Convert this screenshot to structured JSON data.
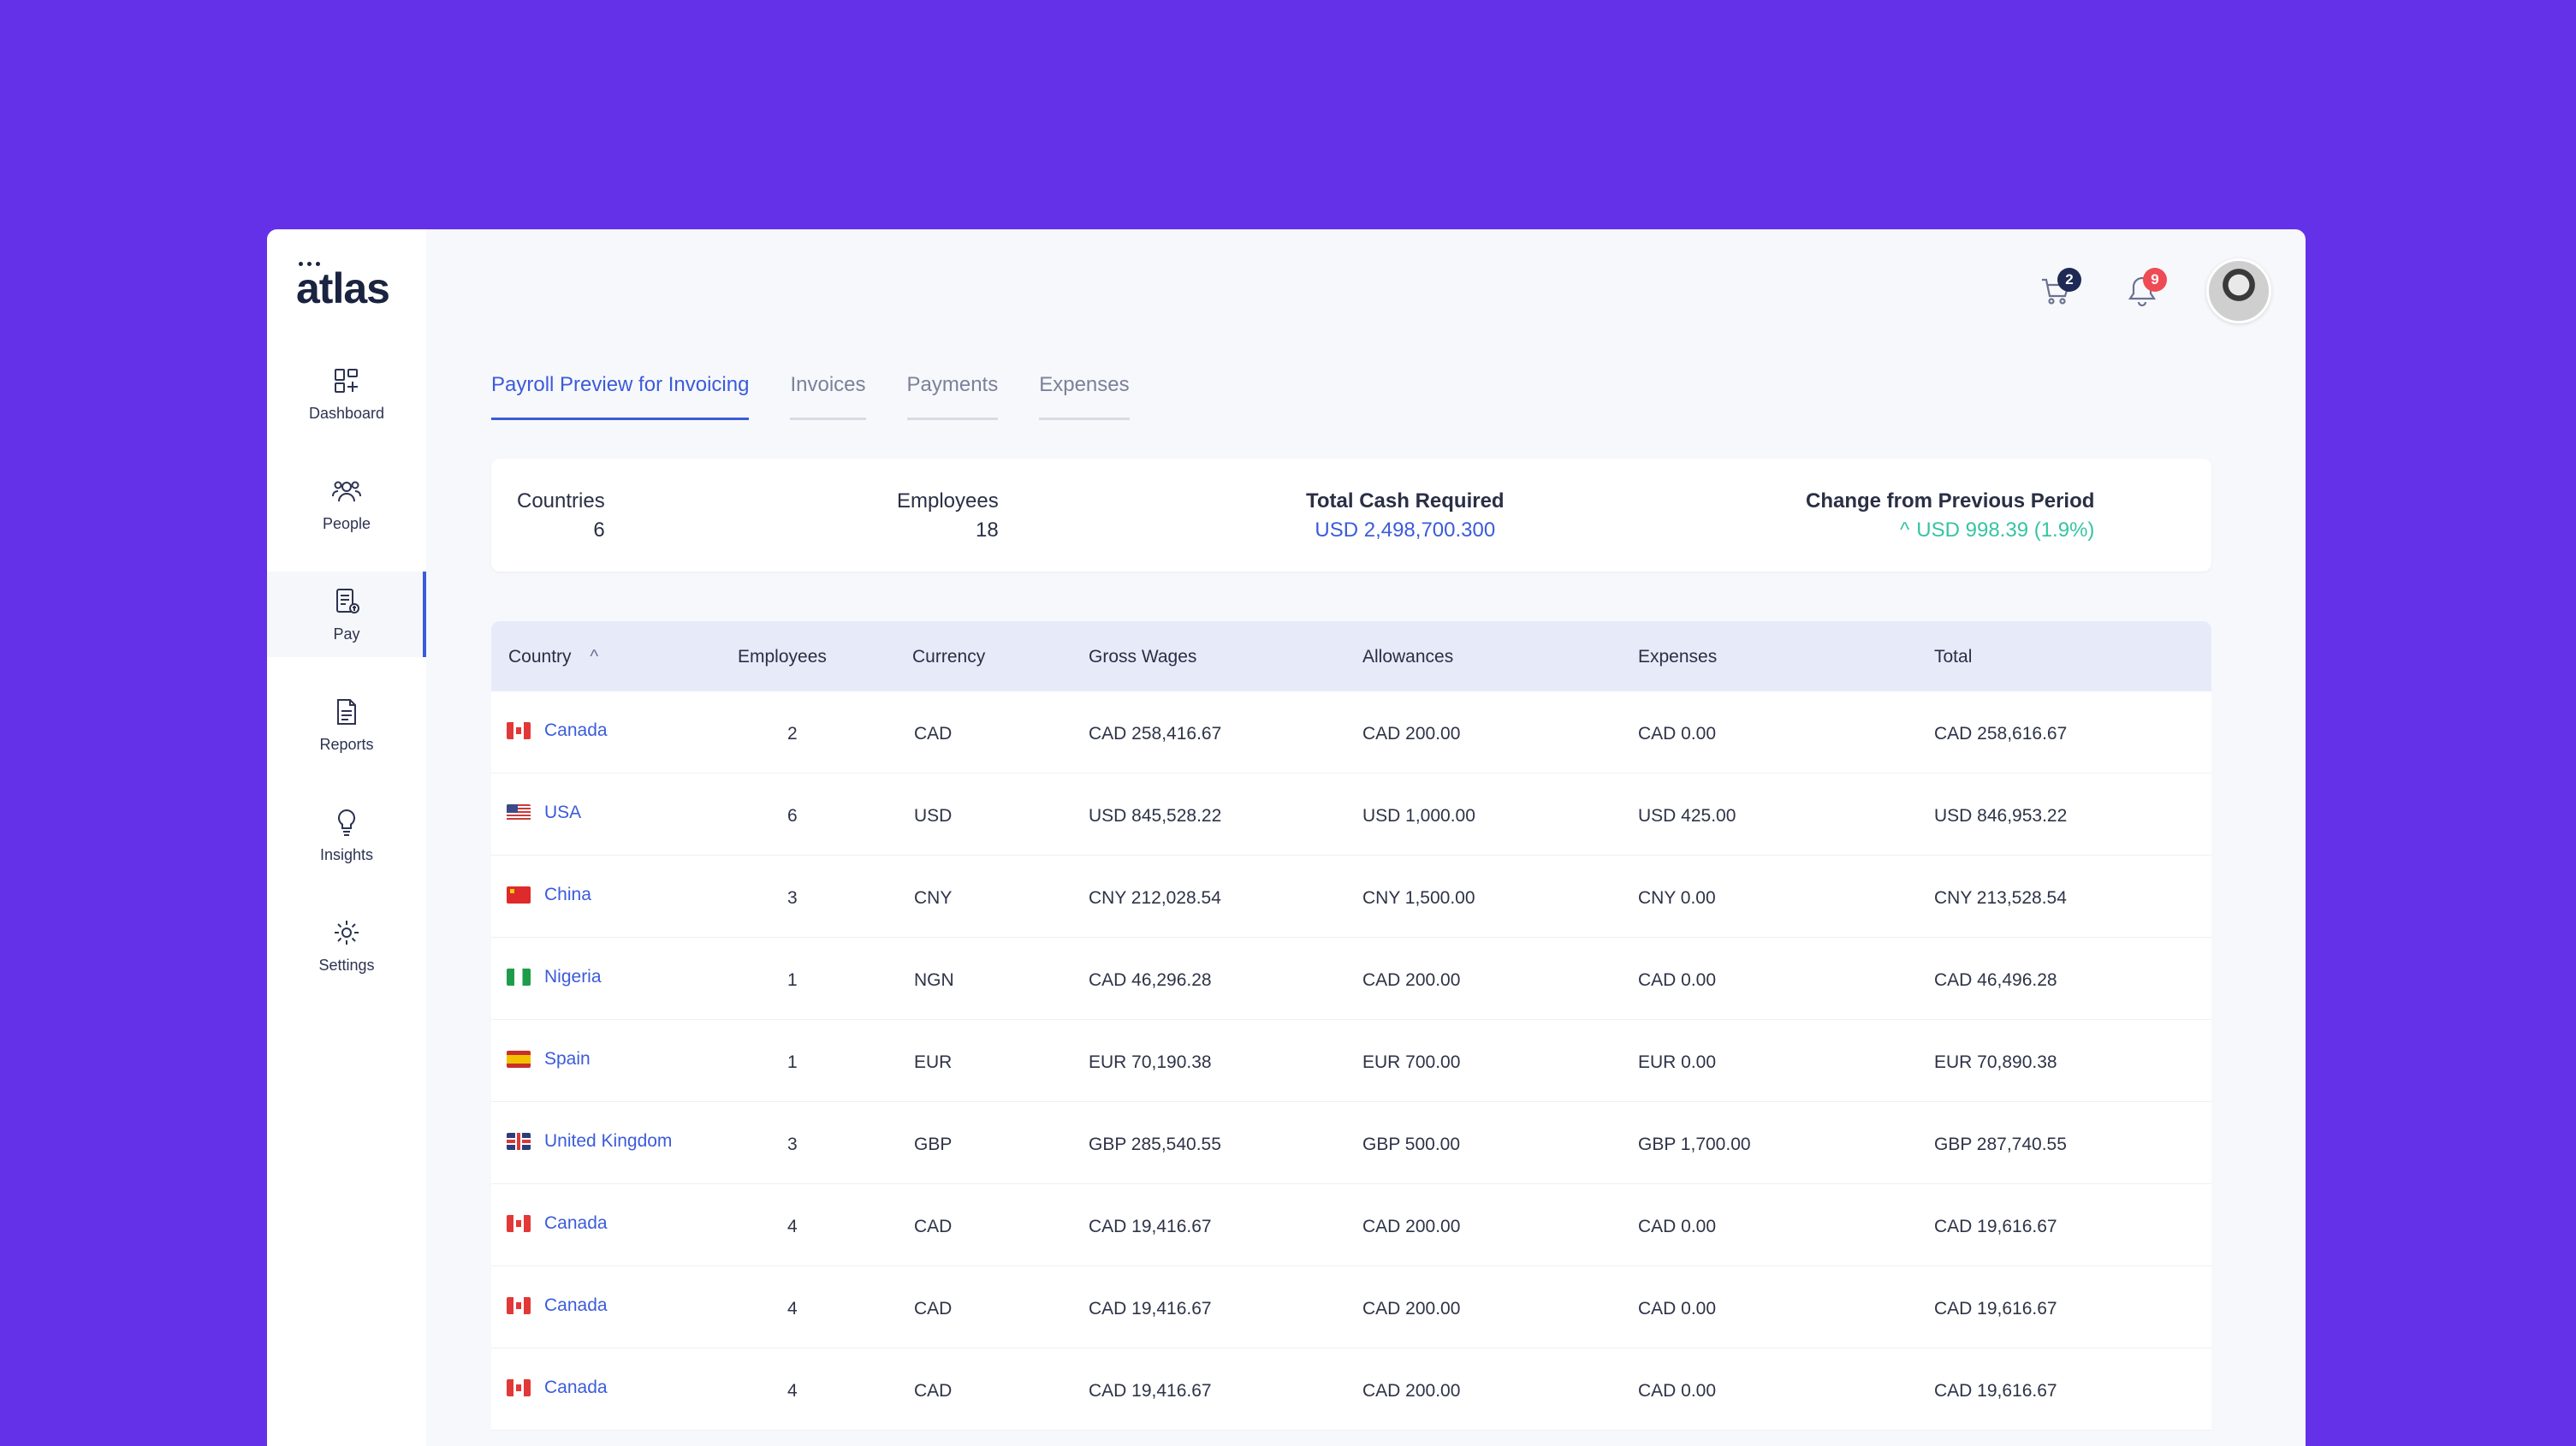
{
  "brand": {
    "name": "atlas"
  },
  "sidebar": {
    "items": [
      {
        "label": "Dashboard",
        "icon": "dashboard-icon"
      },
      {
        "label": "People",
        "icon": "people-icon"
      },
      {
        "label": "Pay",
        "icon": "pay-icon",
        "active": true
      },
      {
        "label": "Reports",
        "icon": "reports-icon"
      },
      {
        "label": "Insights",
        "icon": "insights-icon"
      },
      {
        "label": "Settings",
        "icon": "settings-icon"
      }
    ]
  },
  "header": {
    "cart_badge": "2",
    "notification_badge": "9"
  },
  "tabs": [
    {
      "label": "Payroll Preview for Invoicing",
      "active": true
    },
    {
      "label": "Invoices"
    },
    {
      "label": "Payments"
    },
    {
      "label": "Expenses"
    }
  ],
  "summary": {
    "countries": {
      "label": "Countries",
      "value": "6"
    },
    "employees": {
      "label": "Employees",
      "value": "18"
    },
    "total_cash": {
      "label": "Total Cash Required",
      "value": "USD 2,498,700.300"
    },
    "change": {
      "label": "Change from Previous Period",
      "value": "USD 998.39 (1.9%)"
    }
  },
  "table": {
    "columns": [
      "Country",
      "Employees",
      "Currency",
      "Gross Wages",
      "Allowances",
      "Expenses",
      "Total"
    ],
    "rows": [
      {
        "country": "Canada",
        "flag": "ca",
        "employees": "2",
        "currency": "CAD",
        "gross": "CAD 258,416.67",
        "allowances": "CAD 200.00",
        "expenses": "CAD 0.00",
        "total": "CAD 258,616.67"
      },
      {
        "country": "USA",
        "flag": "us",
        "employees": "6",
        "currency": "USD",
        "gross": "USD 845,528.22",
        "allowances": "USD 1,000.00",
        "expenses": "USD 425.00",
        "total": "USD 846,953.22"
      },
      {
        "country": "China",
        "flag": "cn",
        "employees": "3",
        "currency": "CNY",
        "gross": "CNY 212,028.54",
        "allowances": "CNY 1,500.00",
        "expenses": "CNY 0.00",
        "total": "CNY 213,528.54"
      },
      {
        "country": "Nigeria",
        "flag": "ng",
        "employees": "1",
        "currency": "NGN",
        "gross": "CAD 46,296.28",
        "allowances": "CAD 200.00",
        "expenses": "CAD 0.00",
        "total": "CAD 46,496.28"
      },
      {
        "country": "Spain",
        "flag": "es",
        "employees": "1",
        "currency": "EUR",
        "gross": "EUR 70,190.38",
        "allowances": "EUR 700.00",
        "expenses": "EUR 0.00",
        "total": "EUR 70,890.38"
      },
      {
        "country": "United Kingdom",
        "flag": "gb",
        "employees": "3",
        "currency": "GBP",
        "gross": "GBP 285,540.55",
        "allowances": "GBP 500.00",
        "expenses": "GBP 1,700.00",
        "total": "GBP 287,740.55"
      },
      {
        "country": "Canada",
        "flag": "ca",
        "employees": "4",
        "currency": "CAD",
        "gross": "CAD 19,416.67",
        "allowances": "CAD 200.00",
        "expenses": "CAD 0.00",
        "total": "CAD 19,616.67"
      },
      {
        "country": "Canada",
        "flag": "ca",
        "employees": "4",
        "currency": "CAD",
        "gross": "CAD 19,416.67",
        "allowances": "CAD 200.00",
        "expenses": "CAD 0.00",
        "total": "CAD 19,616.67"
      },
      {
        "country": "Canada",
        "flag": "ca",
        "employees": "4",
        "currency": "CAD",
        "gross": "CAD 19,416.67",
        "allowances": "CAD 200.00",
        "expenses": "CAD 0.00",
        "total": "CAD 19,616.67"
      }
    ]
  },
  "colors": {
    "background": "#6430e8",
    "accent": "#3b5bdb",
    "positive": "#36c4a3",
    "cart_badge": "#1e2a55",
    "notification_badge": "#ef4b55"
  }
}
